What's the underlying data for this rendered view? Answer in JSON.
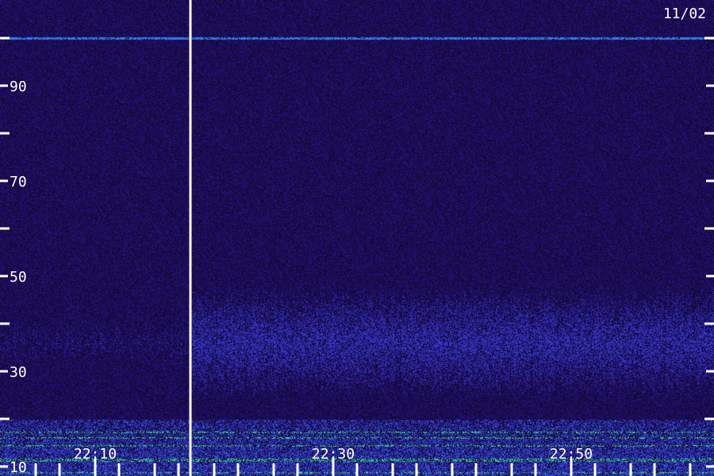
{
  "chart_data": {
    "type": "heatmap",
    "title": "",
    "date_label": "11/02",
    "xlabel": "",
    "ylabel": "",
    "y_axis": {
      "range": [
        8,
        108
      ],
      "major_ticks": [
        10,
        30,
        50,
        70,
        90
      ],
      "major_tick_labels": [
        "10",
        "30",
        "50",
        "70",
        "90"
      ],
      "minor_ticks": [
        20,
        40,
        60,
        80,
        100
      ]
    },
    "x_axis": {
      "range": [
        "22:02",
        "23:02"
      ],
      "labeled_ticks": [
        "22:10",
        "22:30",
        "22:50"
      ],
      "minor_tick_times": [
        "22:05",
        "22:07",
        "22:10",
        "22:12",
        "22:15",
        "22:17",
        "22:20",
        "22:22",
        "22:25",
        "22:27",
        "22:30",
        "22:32",
        "22:35",
        "22:37",
        "22:40",
        "22:42",
        "22:45",
        "22:47",
        "22:50",
        "22:52",
        "22:55",
        "22:57",
        "23:00"
      ]
    },
    "marker_time": "22:18",
    "features": [
      {
        "name": "narrow band line",
        "y": 100,
        "x_range": [
          "22:02",
          "23:02"
        ]
      },
      {
        "name": "broad enhancement",
        "y_range": [
          26,
          46
        ],
        "x_range": [
          "22:18",
          "23:02"
        ]
      },
      {
        "name": "low band activity",
        "y_range": [
          8,
          20
        ],
        "x_range": [
          "22:02",
          "23:02"
        ]
      }
    ],
    "colors": {
      "background": "#22106a",
      "band": "#3a3ad8",
      "line": "#2f8cff",
      "hot": "#3cff80",
      "axis": "#ffffff"
    }
  }
}
